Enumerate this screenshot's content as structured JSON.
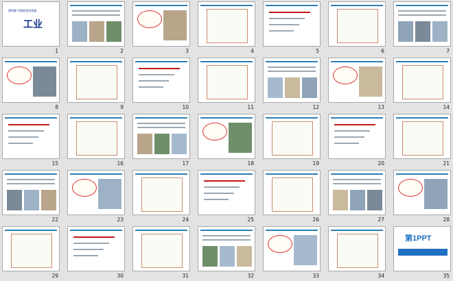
{
  "slides": [
    {
      "number": "1",
      "title": "工业",
      "subtitle": "第四章 中国的经济发展"
    },
    {
      "number": "2"
    },
    {
      "number": "3"
    },
    {
      "number": "4"
    },
    {
      "number": "5"
    },
    {
      "number": "6"
    },
    {
      "number": "7"
    },
    {
      "number": "8"
    },
    {
      "number": "9"
    },
    {
      "number": "10"
    },
    {
      "number": "11"
    },
    {
      "number": "12"
    },
    {
      "number": "13"
    },
    {
      "number": "14"
    },
    {
      "number": "15"
    },
    {
      "number": "16"
    },
    {
      "number": "17"
    },
    {
      "number": "18"
    },
    {
      "number": "19"
    },
    {
      "number": "20"
    },
    {
      "number": "21"
    },
    {
      "number": "22"
    },
    {
      "number": "23"
    },
    {
      "number": "24"
    },
    {
      "number": "25"
    },
    {
      "number": "26"
    },
    {
      "number": "27"
    },
    {
      "number": "28"
    },
    {
      "number": "29"
    },
    {
      "number": "30"
    },
    {
      "number": "31"
    },
    {
      "number": "32"
    },
    {
      "number": "33"
    },
    {
      "number": "34"
    },
    {
      "number": "35",
      "title": "第1PPT"
    }
  ],
  "colors": {
    "background": "#e3e3e3",
    "title_blue": "#1b3a8f",
    "accent_red": "#c01818",
    "brand_blue": "#1f6fc2"
  }
}
